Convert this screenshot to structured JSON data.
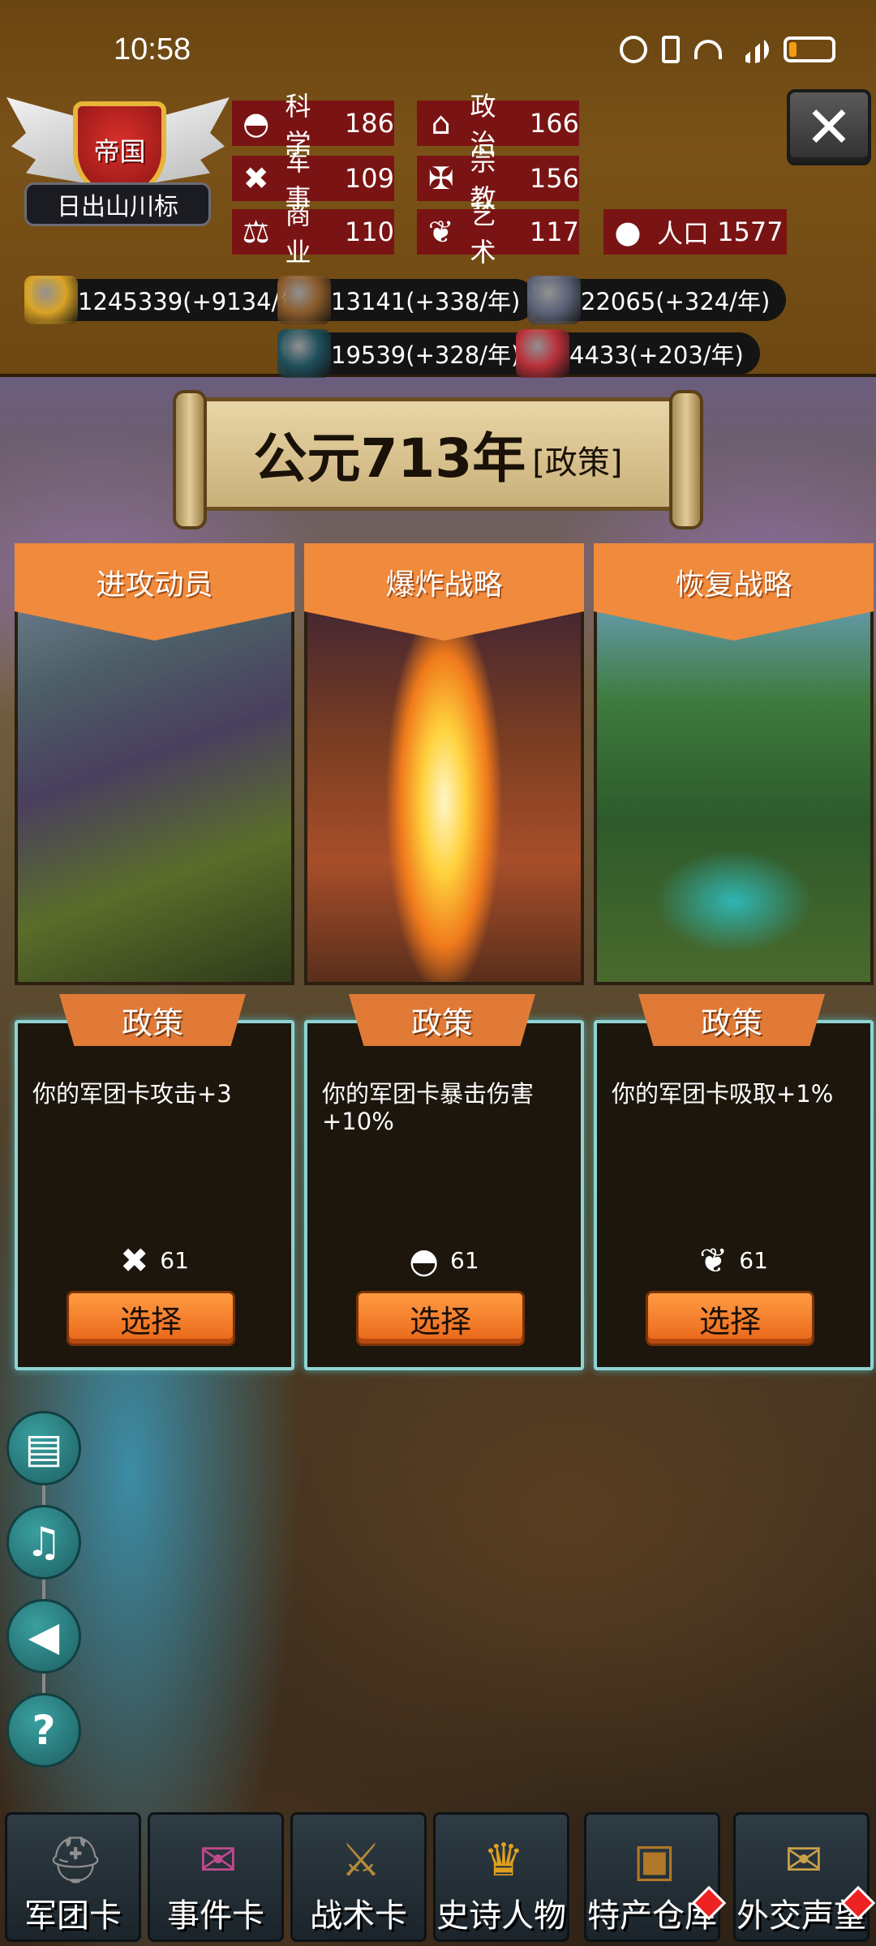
{
  "status_bar": {
    "time": "10:58",
    "battery_percent": 20
  },
  "emblem": {
    "shield_text": "帝国",
    "name": "日出山川标"
  },
  "stats": [
    {
      "icon": "planet-icon",
      "glyph": "◓",
      "label": "科学",
      "value": "186"
    },
    {
      "icon": "temple-icon",
      "glyph": "⌂",
      "label": "政治",
      "value": "166"
    },
    {
      "icon": "crossed-swords-icon",
      "glyph": "✖",
      "label": "军事",
      "value": "109"
    },
    {
      "icon": "cross-icon",
      "glyph": "✠",
      "label": "宗教",
      "value": "156"
    },
    {
      "icon": "scales-icon",
      "glyph": "⚖",
      "label": "商业",
      "value": "110"
    },
    {
      "icon": "lotus-icon",
      "glyph": "❦",
      "label": "艺术",
      "value": "117"
    },
    {
      "icon": "person-icon",
      "glyph": "●",
      "label": "人口",
      "value": "1577"
    }
  ],
  "resources": [
    {
      "icon": "gold-coins-icon",
      "color": "#d9a325",
      "text": "1245339(+9134/年)"
    },
    {
      "icon": "wood-logs-icon",
      "color": "#8a5a2b",
      "text": "13141(+338/年)"
    },
    {
      "icon": "stone-icon",
      "color": "#5c6378",
      "text": "22065(+324/年)"
    },
    {
      "icon": "iron-ingot-icon",
      "color": "#1f4f5c",
      "text": "19539(+328/年)"
    },
    {
      "icon": "meat-icon",
      "color": "#b9303a",
      "text": "4433(+203/年)"
    }
  ],
  "title": {
    "year": "公元713年",
    "tag": "[政策]"
  },
  "cards": [
    {
      "title": "进攻动员",
      "ribbon": "政策",
      "description": "你的军团卡攻击+3",
      "cost_icon": "crossed-swords-icon",
      "cost_glyph": "✖",
      "cost": "61",
      "button": "选择"
    },
    {
      "title": "爆炸战略",
      "ribbon": "政策",
      "description": "你的军团卡暴击伤害+10%",
      "cost_icon": "planet-icon",
      "cost_glyph": "◓",
      "cost": "61",
      "button": "选择"
    },
    {
      "title": "恢复战略",
      "ribbon": "政策",
      "description": "你的军团卡吸取+1%",
      "cost_icon": "lotus-icon",
      "cost_glyph": "❦",
      "cost": "61",
      "button": "选择"
    }
  ],
  "side_buttons": [
    {
      "icon": "book-icon",
      "glyph": "▤"
    },
    {
      "icon": "music-icon",
      "glyph": "♫"
    },
    {
      "icon": "speaker-icon",
      "glyph": "◀"
    },
    {
      "icon": "help-icon",
      "glyph": "?"
    }
  ],
  "nav": [
    {
      "icon": "helmet-icon",
      "glyph": "⛑",
      "color": "#8f8f8f",
      "label": "军团卡",
      "badge": false
    },
    {
      "icon": "scroll-icon",
      "glyph": "✉",
      "color": "#c04a8e",
      "label": "事件卡",
      "badge": false
    },
    {
      "icon": "shield-swords-icon",
      "glyph": "⚔",
      "color": "#b38a3a",
      "label": "战术卡",
      "badge": false
    },
    {
      "icon": "crown-icon",
      "glyph": "♛",
      "color": "#e0a020",
      "label": "史诗人物",
      "badge": false
    },
    {
      "icon": "treasure-chest-icon",
      "glyph": "▣",
      "color": "#b07828",
      "label": "特产仓库",
      "badge": true
    },
    {
      "icon": "envelope-icon",
      "glyph": "✉",
      "color": "#c9a04a",
      "label": "外交声望",
      "badge": true
    }
  ]
}
